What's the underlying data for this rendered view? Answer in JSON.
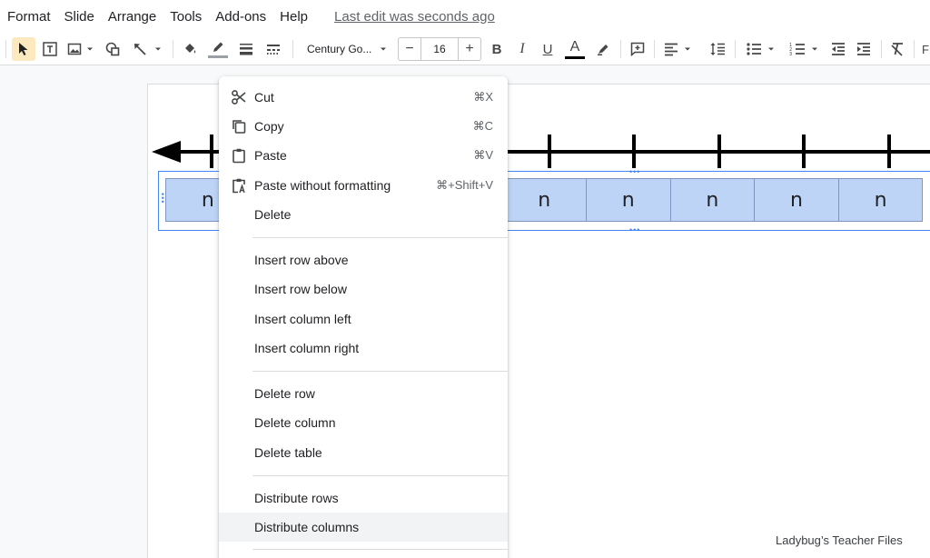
{
  "menubar": {
    "items": [
      "Format",
      "Slide",
      "Arrange",
      "Tools",
      "Add-ons",
      "Help"
    ],
    "last_edit": "Last edit was seconds ago"
  },
  "toolbar": {
    "font": "Century Go...",
    "font_size": "16",
    "minus": "−",
    "plus": "+",
    "bold": "B",
    "italic": "I",
    "underline": "U",
    "text_color": "A",
    "edge_label": "F"
  },
  "slide": {
    "table_cells": [
      "n",
      "n",
      "n",
      "n",
      "n",
      "n",
      "n",
      "n",
      "n"
    ],
    "watermark": "Ladybug’s Teacher Files"
  },
  "context_menu": {
    "groups": [
      [
        {
          "label": "Cut",
          "shortcut": "⌘X",
          "icon": "scissors-icon"
        },
        {
          "label": "Copy",
          "shortcut": "⌘C",
          "icon": "copy-icon"
        },
        {
          "label": "Paste",
          "shortcut": "⌘V",
          "icon": "clipboard-icon"
        },
        {
          "label": "Paste without formatting",
          "shortcut": "⌘+Shift+V",
          "icon": "paste-plain-icon"
        },
        {
          "label": "Delete",
          "shortcut": ""
        }
      ],
      [
        {
          "label": "Insert row above"
        },
        {
          "label": "Insert row below"
        },
        {
          "label": "Insert column left"
        },
        {
          "label": "Insert column right"
        }
      ],
      [
        {
          "label": "Delete row"
        },
        {
          "label": "Delete column"
        },
        {
          "label": "Delete table"
        }
      ],
      [
        {
          "label": "Distribute rows"
        },
        {
          "label": "Distribute columns",
          "hovered": true
        }
      ]
    ]
  },
  "colors": {
    "table_fill": "#bdd4f7",
    "selection": "#4285f4",
    "active_tool": "#fde9bf",
    "menu_hover": "#f1f3f4"
  }
}
